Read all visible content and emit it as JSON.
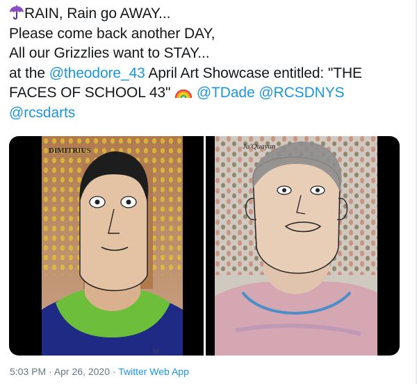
{
  "tweet": {
    "lines": [
      {
        "icon": "umbrella-icon",
        "text": "RAIN, Rain go AWAY..."
      },
      {
        "text": "Please come back another DAY,"
      },
      {
        "text": "All our Grizzlies want to STAY..."
      },
      {
        "pre": "at the ",
        "mention": "@theodore_43",
        "post": " April Art Showcase entitled: \"THE"
      },
      {
        "pre": "FACES OF SCHOOL 43\" ",
        "icon": "rainbow-icon",
        "mention1": "@TDade",
        "mention2": "@RCSDNYS"
      },
      {
        "mention": "@rcsdarts"
      }
    ]
  },
  "media": {
    "image1_label": "DIMITRIUS",
    "image1_corner": "98",
    "image2_label": "Ja'Quayan"
  },
  "footer": {
    "time": "5:03 PM",
    "sep1": " · ",
    "date": "Apr 26, 2020",
    "sep2": " · ",
    "source": "Twitter Web App"
  }
}
